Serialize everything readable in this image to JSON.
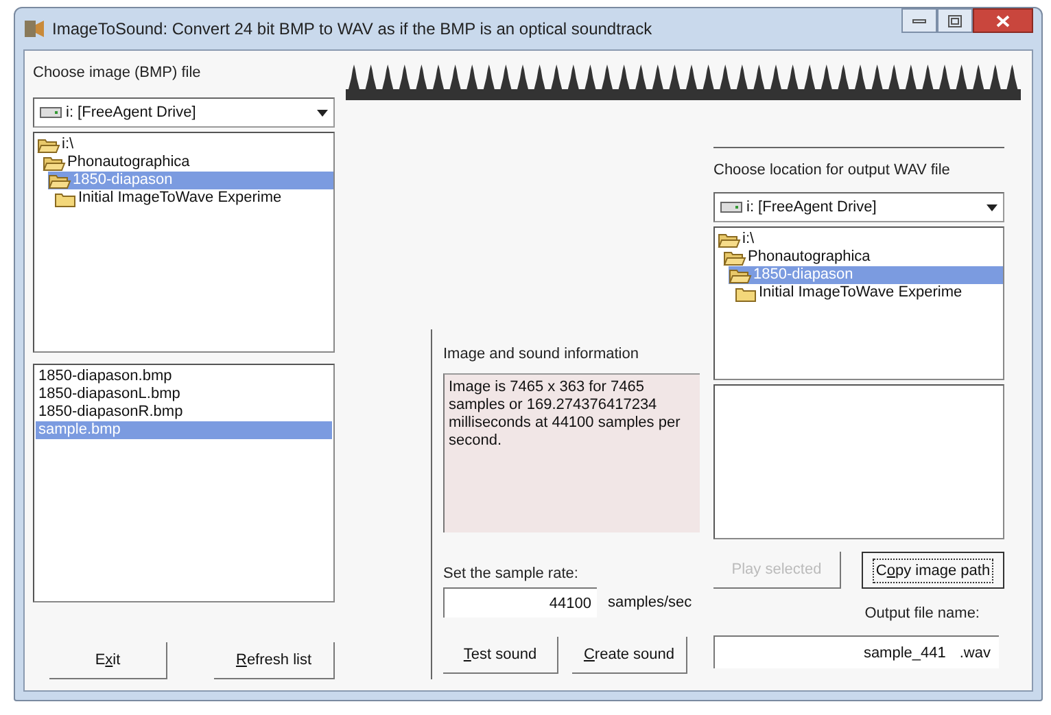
{
  "window": {
    "title": "ImageToSound: Convert 24 bit BMP to WAV as if the BMP is an optical soundtrack"
  },
  "source": {
    "label": "Choose image (BMP) file",
    "drive": "i: [FreeAgent Drive]",
    "folders": [
      {
        "name": "i:\\",
        "selected": false,
        "children": [
          {
            "name": "Phonautographica",
            "selected": false,
            "children": [
              {
                "name": "1850-diapason",
                "selected": true,
                "children": [
                  {
                    "name": "Initial ImageToWave Experime",
                    "selected": false
                  }
                ]
              }
            ]
          }
        ]
      }
    ],
    "files": [
      {
        "name": "1850-diapason.bmp",
        "selected": false
      },
      {
        "name": "1850-diapasonL.bmp",
        "selected": false
      },
      {
        "name": "1850-diapasonR.bmp",
        "selected": false
      },
      {
        "name": "sample.bmp",
        "selected": true
      }
    ],
    "buttons": [
      {
        "parts": [
          {
            "text": "E"
          },
          {
            "text": "x",
            "underline": true
          },
          {
            "text": "it"
          }
        ],
        "disabled": false,
        "focused": false
      },
      {
        "parts": [
          {
            "text": "R",
            "underline": true
          },
          {
            "text": "efresh list"
          }
        ],
        "disabled": false,
        "focused": false
      }
    ]
  },
  "info": {
    "label": "Image and sound information",
    "text": "Image is 7465 x 363 for 7465 samples or 169.274376417234 milliseconds at 44100 samples per second."
  },
  "sample_rate": {
    "label": "Set the sample rate:",
    "value": "44100",
    "unit": "samples/sec"
  },
  "sound_buttons": [
    {
      "parts": [
        {
          "text": "T",
          "underline": true
        },
        {
          "text": "est sound"
        }
      ],
      "disabled": false,
      "focused": false
    },
    {
      "parts": [
        {
          "text": "C",
          "underline": true
        },
        {
          "text": "reate sound"
        }
      ],
      "disabled": false,
      "focused": false
    }
  ],
  "output": {
    "label": "Choose location for output WAV file",
    "drive": "i: [FreeAgent Drive]",
    "folders": [
      {
        "name": "i:\\",
        "selected": false,
        "children": [
          {
            "name": "Phonautographica",
            "selected": false,
            "children": [
              {
                "name": "1850-diapason",
                "selected": true,
                "children": [
                  {
                    "name": "Initial ImageToWave Experime",
                    "selected": false
                  }
                ]
              }
            ]
          }
        ]
      }
    ],
    "buttons": [
      {
        "parts": [
          {
            "text": "Play selected"
          }
        ],
        "disabled": true,
        "focused": false
      },
      {
        "parts": [
          {
            "text": "C"
          },
          {
            "text": "o",
            "underline": true
          },
          {
            "text": "py image path"
          }
        ],
        "disabled": false,
        "focused": true
      }
    ]
  },
  "output_name": {
    "label": "Output file name:",
    "value": "sample_441",
    "extension": ".wav"
  }
}
